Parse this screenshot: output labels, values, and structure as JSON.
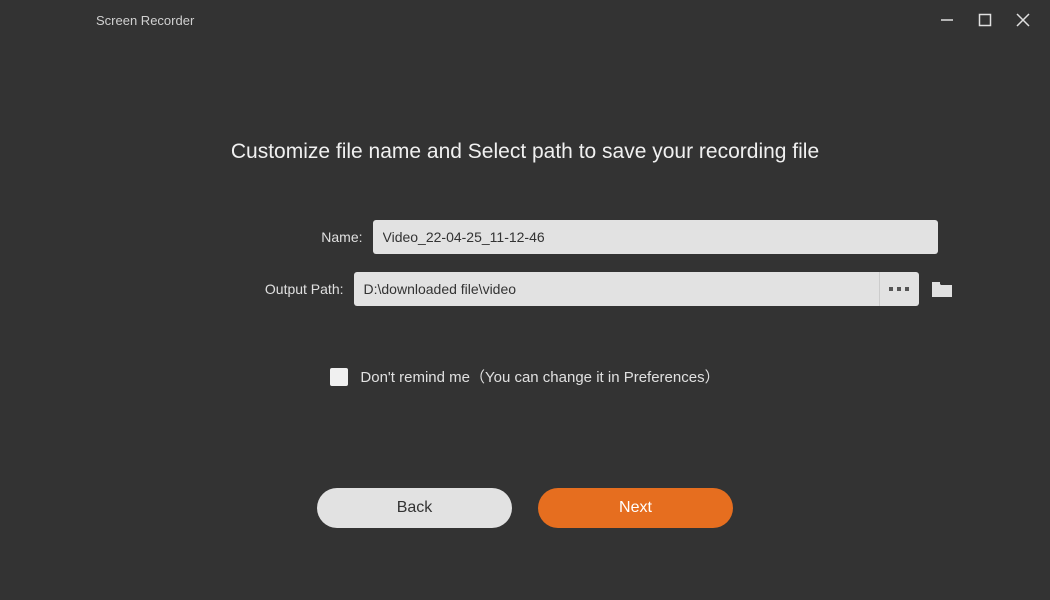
{
  "window": {
    "title": "Screen Recorder"
  },
  "heading": "Customize file name and Select path to save your recording file",
  "form": {
    "name_label": "Name:",
    "name_value": "Video_22-04-25_11-12-46",
    "path_label": "Output Path:",
    "path_value": "D:\\downloaded file\\video"
  },
  "remind": {
    "label": "Don't remind me（You can change it in Preferences）"
  },
  "buttons": {
    "back": "Back",
    "next": "Next"
  },
  "colors": {
    "accent": "#e66e1f",
    "bg": "#333333"
  }
}
